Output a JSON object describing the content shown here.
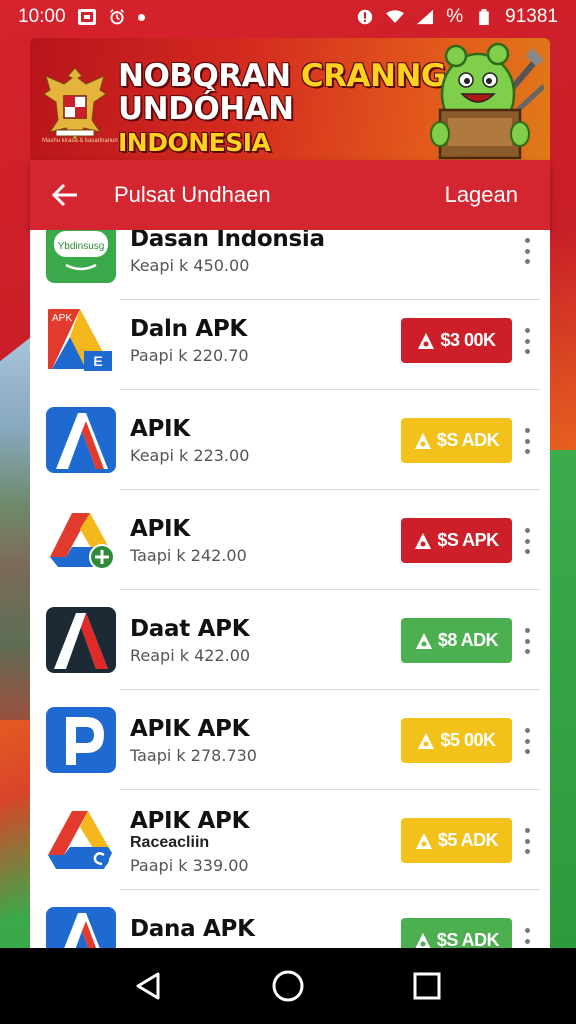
{
  "status_bar": {
    "time": "10:00",
    "battery_text": "%",
    "right_text": "91381"
  },
  "banner": {
    "line1_white": "NOBQRAN ",
    "line1_yellow": "CRANNG",
    "line2_white": "UNDÓHAN ",
    "line2_yellow": "INDONESIA",
    "emblem_caption": "Mashu kirasa & kasarinanun"
  },
  "header": {
    "title": "Pulsat Undhaen",
    "action": "Lagean"
  },
  "apps": [
    {
      "name": "Dasan Indonsia",
      "sub": "",
      "price": "Keapi k 450.00",
      "button": "",
      "button_color": "",
      "icon": "green-badge-icon",
      "icon_text": "Ybdinsusg"
    },
    {
      "name": "Daln APK",
      "sub": "",
      "price": "Paapi k 220.70",
      "button": "$3 00K",
      "button_color": "#cc1f2a",
      "icon": "apk-triangle-icon",
      "icon_text": "APK"
    },
    {
      "name": "APIK",
      "sub": "",
      "price": "Keapi k 223.00",
      "button": "$S ADK",
      "button_color": "#f2c21a",
      "icon": "blue-a-icon",
      "icon_text": ""
    },
    {
      "name": "APIK",
      "sub": "",
      "price": "Taapi k 242.00",
      "button": "$S APK",
      "button_color": "#cc1f2a",
      "icon": "drive-plus-icon",
      "icon_text": ""
    },
    {
      "name": "Daat APK",
      "sub": "",
      "price": "Reapi k 422.00",
      "button": "$8 ADK",
      "button_color": "#4caf50",
      "icon": "dark-a-icon",
      "icon_text": ""
    },
    {
      "name": "APIK APK",
      "sub": "",
      "price": "Taapi k 278.730",
      "button": "$5 00K",
      "button_color": "#f2c21a",
      "icon": "blue-p-icon",
      "icon_text": ""
    },
    {
      "name": "APIK APK",
      "sub": "Raceacliin",
      "price": "Paapi k 339.00",
      "button": "$5 ADK",
      "button_color": "#f2c21a",
      "icon": "drive-c-icon",
      "icon_text": ""
    },
    {
      "name": "Dana APK",
      "sub": "",
      "price": "",
      "button": "$S ADK",
      "button_color": "#4caf50",
      "icon": "blue-a-icon",
      "icon_text": ""
    }
  ]
}
